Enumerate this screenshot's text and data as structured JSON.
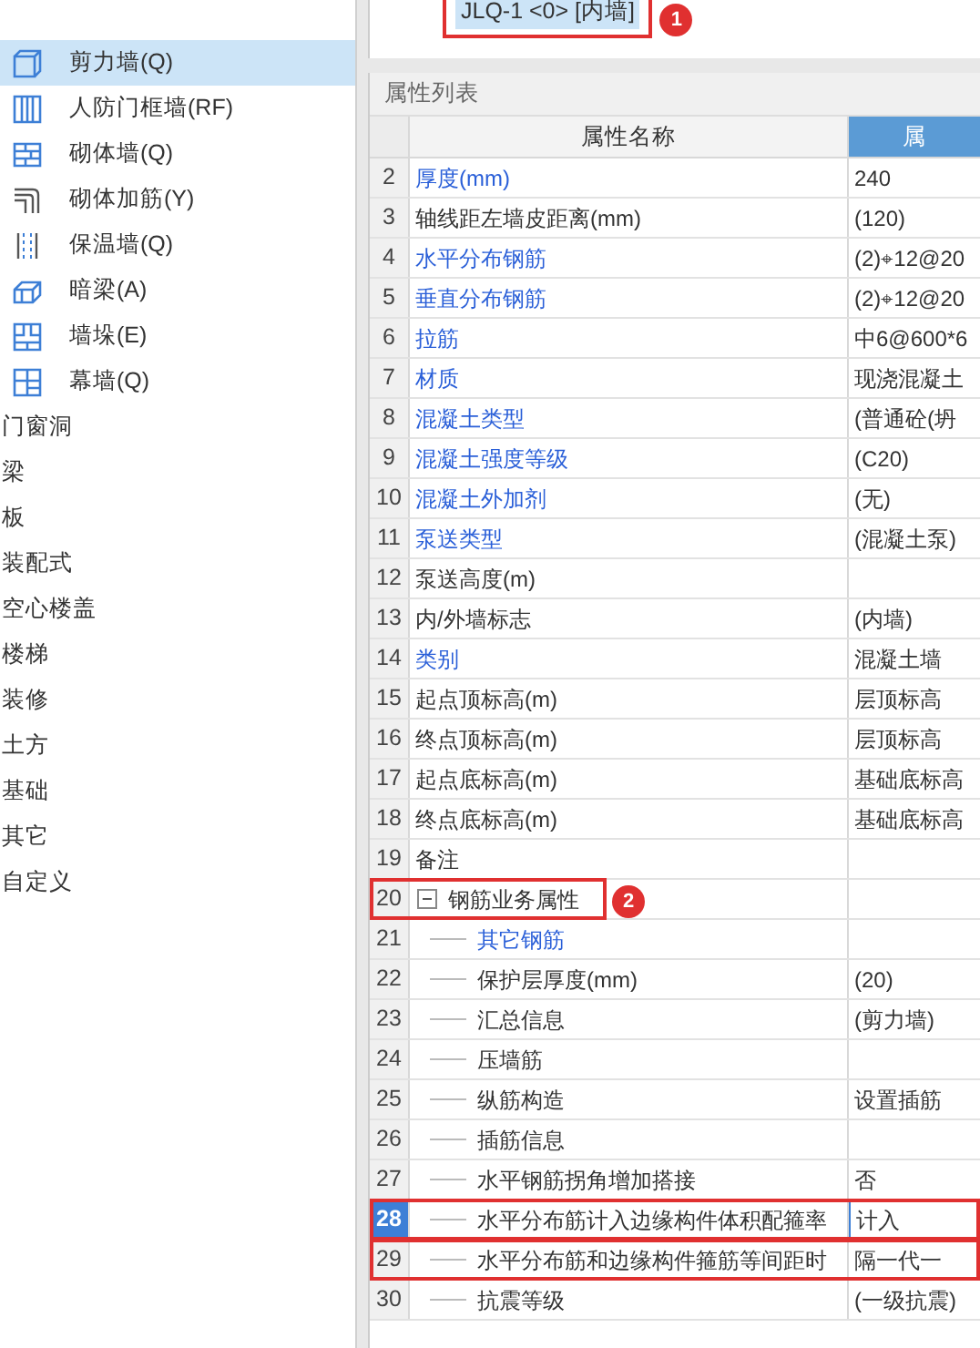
{
  "sidebar": {
    "components": [
      {
        "label": "剪力墙(Q)",
        "selected": true
      },
      {
        "label": "人防门框墙(RF)",
        "selected": false
      },
      {
        "label": "砌体墙(Q)",
        "selected": false
      },
      {
        "label": "砌体加筋(Y)",
        "selected": false
      },
      {
        "label": "保温墙(Q)",
        "selected": false
      },
      {
        "label": "暗梁(A)",
        "selected": false
      },
      {
        "label": "墙垛(E)",
        "selected": false
      },
      {
        "label": "幕墙(Q)",
        "selected": false
      }
    ],
    "categories": [
      "门窗洞",
      "梁",
      "板",
      "装配式",
      "空心楼盖",
      "楼梯",
      "装修",
      "土方",
      "基础",
      "其它",
      "自定义"
    ]
  },
  "component_label": {
    "text": "JLQ-1 <0> [内墙]",
    "callout": "1"
  },
  "properties": {
    "title": "属性列表",
    "columns": [
      "属性名称",
      "属"
    ],
    "rows": [
      {
        "num": "2",
        "name": "厚度(mm)",
        "value": "240",
        "link": true,
        "selected": false
      },
      {
        "num": "3",
        "name": "轴线距左墙皮距离(mm)",
        "value": "(120)",
        "link": false,
        "selected": false
      },
      {
        "num": "4",
        "name": "水平分布钢筋",
        "value": "(2)⌖12@20",
        "link": true,
        "selected": false
      },
      {
        "num": "5",
        "name": "垂直分布钢筋",
        "value": "(2)⌖12@20",
        "link": true,
        "selected": false
      },
      {
        "num": "6",
        "name": "拉筋",
        "value": "中6@600*6",
        "link": true,
        "selected": false
      },
      {
        "num": "7",
        "name": "材质",
        "value": "现浇混凝土",
        "link": true,
        "selected": false
      },
      {
        "num": "8",
        "name": "混凝土类型",
        "value": "(普通砼(坍",
        "link": true,
        "selected": false
      },
      {
        "num": "9",
        "name": "混凝土强度等级",
        "value": "(C20)",
        "link": true,
        "selected": false
      },
      {
        "num": "10",
        "name": "混凝土外加剂",
        "value": "(无)",
        "link": true,
        "selected": false
      },
      {
        "num": "11",
        "name": "泵送类型",
        "value": "(混凝土泵)",
        "link": true,
        "selected": false
      },
      {
        "num": "12",
        "name": "泵送高度(m)",
        "link": false,
        "selected": false
      },
      {
        "num": "13",
        "name": "内/外墙标志",
        "value": "(内墙)",
        "link": false,
        "selected": false
      },
      {
        "num": "14",
        "name": "类别",
        "value": "混凝土墙",
        "link": true,
        "selected": false
      },
      {
        "num": "15",
        "name": "起点顶标高(m)",
        "value": "层顶标高",
        "link": false,
        "selected": false
      },
      {
        "num": "16",
        "name": "终点顶标高(m)",
        "value": "层顶标高",
        "link": false,
        "selected": false
      },
      {
        "num": "17",
        "name": "起点底标高(m)",
        "value": "基础底标高",
        "link": false,
        "selected": false
      },
      {
        "num": "18",
        "name": "终点底标高(m)",
        "value": "基础底标高",
        "link": false,
        "selected": false
      },
      {
        "num": "19",
        "name": "备注",
        "link": false,
        "selected": false
      },
      {
        "num": "20",
        "name": "钢筋业务属性",
        "link": false,
        "selected": false,
        "expanded": true,
        "outlined": true,
        "outline_spans_row": false,
        "callout": "2",
        "children": [
          {
            "num": "21",
            "name": "其它钢筋",
            "link": true,
            "selected": false
          },
          {
            "num": "22",
            "name": "保护层厚度(mm)",
            "value": "(20)",
            "link": false,
            "selected": false
          },
          {
            "num": "23",
            "name": "汇总信息",
            "value": "(剪力墙)",
            "link": false,
            "selected": false
          },
          {
            "num": "24",
            "name": "压墙筋",
            "link": false,
            "selected": false
          },
          {
            "num": "25",
            "name": "纵筋构造",
            "value": "设置插筋",
            "link": false,
            "selected": false
          },
          {
            "num": "26",
            "name": "插筋信息",
            "link": false,
            "selected": false
          },
          {
            "num": "27",
            "name": "水平钢筋拐角增加搭接",
            "value": "否",
            "link": false,
            "selected": false
          },
          {
            "num": "28",
            "name": "水平分布筋计入边缘构件体积配箍率",
            "value": "计入",
            "link": false,
            "selected": true,
            "outlined": true,
            "outline_spans_row": true
          },
          {
            "num": "29",
            "name": "水平分布筋和边缘构件箍筋等间距时",
            "value": "隔一代一",
            "link": false,
            "selected": false,
            "outlined": true,
            "outline_spans_row": true
          },
          {
            "num": "30",
            "name": "抗震等级",
            "value": "(一级抗震)",
            "link": false,
            "selected": false
          }
        ]
      }
    ]
  }
}
